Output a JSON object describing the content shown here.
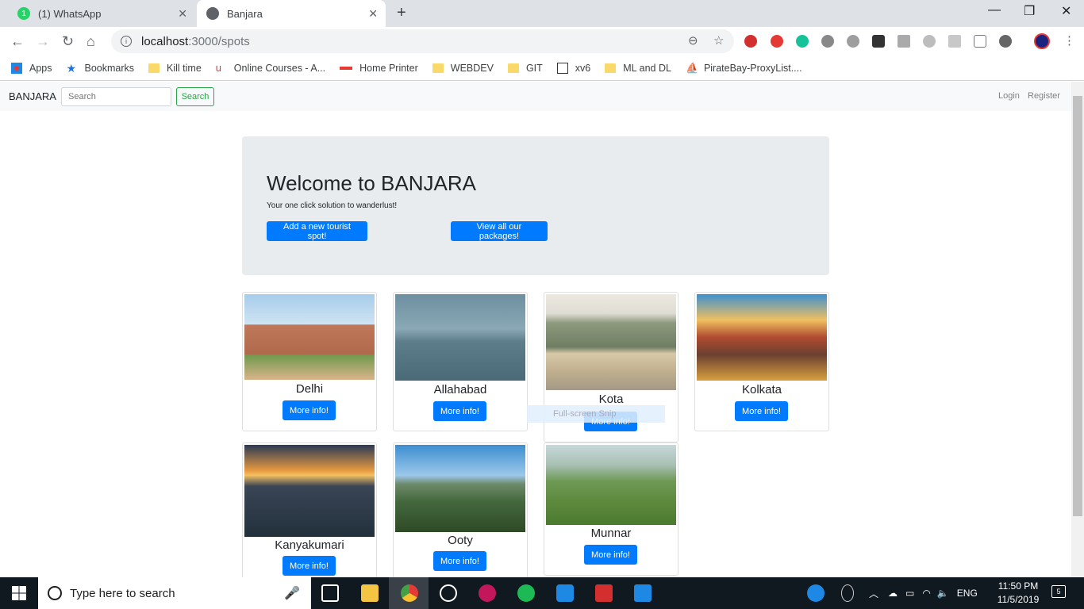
{
  "browser": {
    "tabs": [
      {
        "label": "(1) WhatsApp",
        "badge": "1"
      },
      {
        "label": "Banjara"
      }
    ],
    "url_host": "localhost",
    "url_path": ":3000/spots",
    "bookmarks": [
      "Apps",
      "Bookmarks",
      "Kill time",
      "Online Courses - A...",
      "Home Printer",
      "WEBDEV",
      "GIT",
      "xv6",
      "ML and DL",
      "PirateBay-ProxyList...."
    ]
  },
  "navbar": {
    "brand": "BANJARA",
    "search_placeholder": "Search",
    "search_button": "Search",
    "login": "Login",
    "register": "Register"
  },
  "jumbotron": {
    "title": "Welcome to BANJARA",
    "subtitle": "Your one click solution to wanderlust!",
    "add_button": "Add a new tourist spot!",
    "packages_button": "View all our packages!"
  },
  "spots": [
    {
      "name": "Delhi",
      "button": "More info!"
    },
    {
      "name": "Allahabad",
      "button": "More info!"
    },
    {
      "name": "Kota",
      "button": "More info!"
    },
    {
      "name": "Kolkata",
      "button": "More info!"
    },
    {
      "name": "Kanyakumari",
      "button": "More info!"
    },
    {
      "name": "Ooty",
      "button": "More info!"
    },
    {
      "name": "Munnar",
      "button": "More info!"
    }
  ],
  "overlay": {
    "fullscreen_text": "Full-screen Snip"
  },
  "taskbar": {
    "search_placeholder": "Type here to search",
    "language": "ENG",
    "time": "11:50 PM",
    "date": "11/5/2019",
    "notifications": "5"
  },
  "colors": {
    "primary": "#007bff",
    "success": "#28a745",
    "jumbotron": "#e9ecef",
    "taskbar": "#101820"
  }
}
